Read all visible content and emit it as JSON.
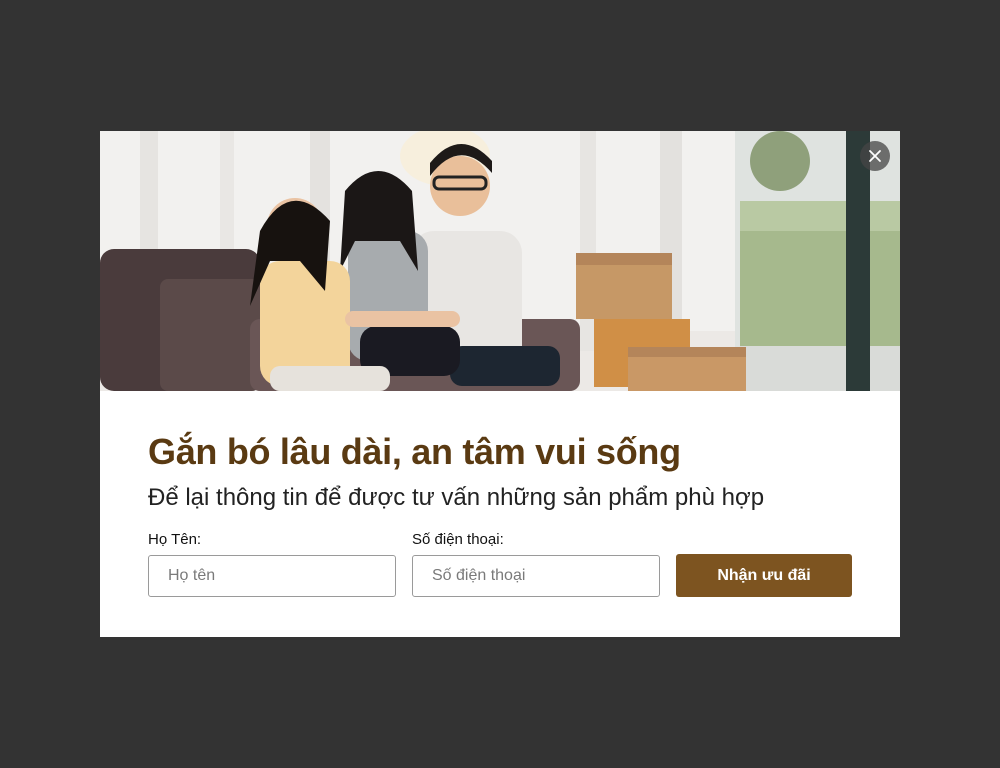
{
  "modal": {
    "hero_image": "family-moving-into-new-home-photo",
    "close_icon": "close-icon",
    "title": "Gắn bó lâu dài, an tâm vui sống",
    "subtitle": "Để lại thông tin để được tư vấn những sản phẩm phù hợp",
    "form": {
      "name_label": "Họ Tên:",
      "name_placeholder": "Họ tên",
      "name_value": "",
      "phone_label": "Số điện thoại:",
      "phone_placeholder": "Số điện thoại",
      "phone_value": "",
      "submit_label": "Nhận ưu đãi"
    }
  },
  "colors": {
    "overlay": "#333333",
    "title": "#5a3a12",
    "button": "#7d5420",
    "panel": "#ffffff"
  }
}
